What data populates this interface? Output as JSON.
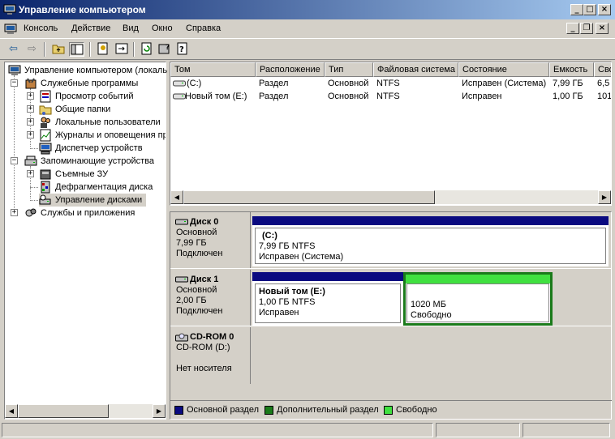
{
  "window": {
    "title": "Управление компьютером",
    "icon": "computer-management-icon"
  },
  "mdi_child_controls": {
    "minimize": "_",
    "restore": "❐",
    "close": "×"
  },
  "menu": [
    "Консоль",
    "Действие",
    "Вид",
    "Окно",
    "Справка"
  ],
  "toolbar_icons": [
    "back-arrow-icon",
    "forward-arrow-icon",
    "up-folder-icon",
    "show-hide-tree-icon",
    "properties-icon",
    "export-list-icon",
    "refresh-icon",
    "help-icon",
    "help-topics-icon"
  ],
  "tree": {
    "root": "Управление компьютером (локаль",
    "items": [
      {
        "label": "Служебные программы",
        "level": 1,
        "expander": "−",
        "icon": "tools-icon"
      },
      {
        "label": "Просмотр событий",
        "level": 2,
        "expander": "+",
        "icon": "event-viewer-icon"
      },
      {
        "label": "Общие папки",
        "level": 2,
        "expander": "+",
        "icon": "shared-folder-icon"
      },
      {
        "label": "Локальные пользователи",
        "level": 2,
        "expander": "+",
        "icon": "users-icon"
      },
      {
        "label": "Журналы и оповещения пр",
        "level": 2,
        "expander": "+",
        "icon": "performance-logs-icon"
      },
      {
        "label": "Диспетчер устройств",
        "level": 2,
        "expander": "",
        "icon": "device-manager-icon"
      },
      {
        "label": "Запоминающие устройства",
        "level": 1,
        "expander": "−",
        "icon": "storage-icon"
      },
      {
        "label": "Съемные ЗУ",
        "level": 2,
        "expander": "+",
        "icon": "removable-storage-icon"
      },
      {
        "label": "Дефрагментация диска",
        "level": 2,
        "expander": "",
        "icon": "defrag-icon"
      },
      {
        "label": "Управление дисками",
        "level": 2,
        "expander": "",
        "icon": "disk-management-icon",
        "selected": true
      },
      {
        "label": "Службы и приложения",
        "level": 1,
        "expander": "+",
        "icon": "services-icon"
      }
    ]
  },
  "volumes": {
    "columns": [
      "Том",
      "Расположение",
      "Тип",
      "Файловая система",
      "Состояние",
      "Емкость",
      "Сво"
    ],
    "rows": [
      [
        "(C:)",
        "Раздел",
        "Основной",
        "NTFS",
        "Исправен (Система)",
        "7,99 ГБ",
        "6,5"
      ],
      [
        "Новый том (E:)",
        "Раздел",
        "Основной",
        "NTFS",
        "Исправен",
        "1,00 ГБ",
        "101"
      ]
    ]
  },
  "disks": [
    {
      "name": "Диск 0",
      "type": "Основной",
      "size": "7,99 ГБ",
      "state": "Подключен",
      "partitions": [
        {
          "title": "(C:)",
          "line1": "7,99 ГБ NTFS",
          "line2": "Исправен (Система)",
          "kind": "primary"
        }
      ]
    },
    {
      "name": "Диск 1",
      "type": "Основной",
      "size": "2,00 ГБ",
      "state": "Подключен",
      "partitions": [
        {
          "title": "Новый том  (E:)",
          "line1": "1,00 ГБ NTFS",
          "line2": "Исправен",
          "kind": "primary"
        },
        {
          "title": "",
          "line1": "1020 МБ",
          "line2": "Свободно",
          "kind": "free"
        }
      ]
    },
    {
      "name": "CD-ROM 0",
      "type": "CD-ROM (D:)",
      "size": "",
      "state": "Нет носителя",
      "partitions": []
    }
  ],
  "legend": [
    {
      "label": "Основной раздел",
      "color": "#0a0a80"
    },
    {
      "label": "Дополнительный раздел",
      "color": "#1a7a1a"
    },
    {
      "label": "Свободно",
      "color": "#40e040"
    }
  ],
  "colors": {
    "primary": "#0a0a80",
    "free": "#40e040",
    "free_border": "#1a7a1a",
    "title_start": "#0a246a",
    "title_end": "#a6caf0"
  }
}
